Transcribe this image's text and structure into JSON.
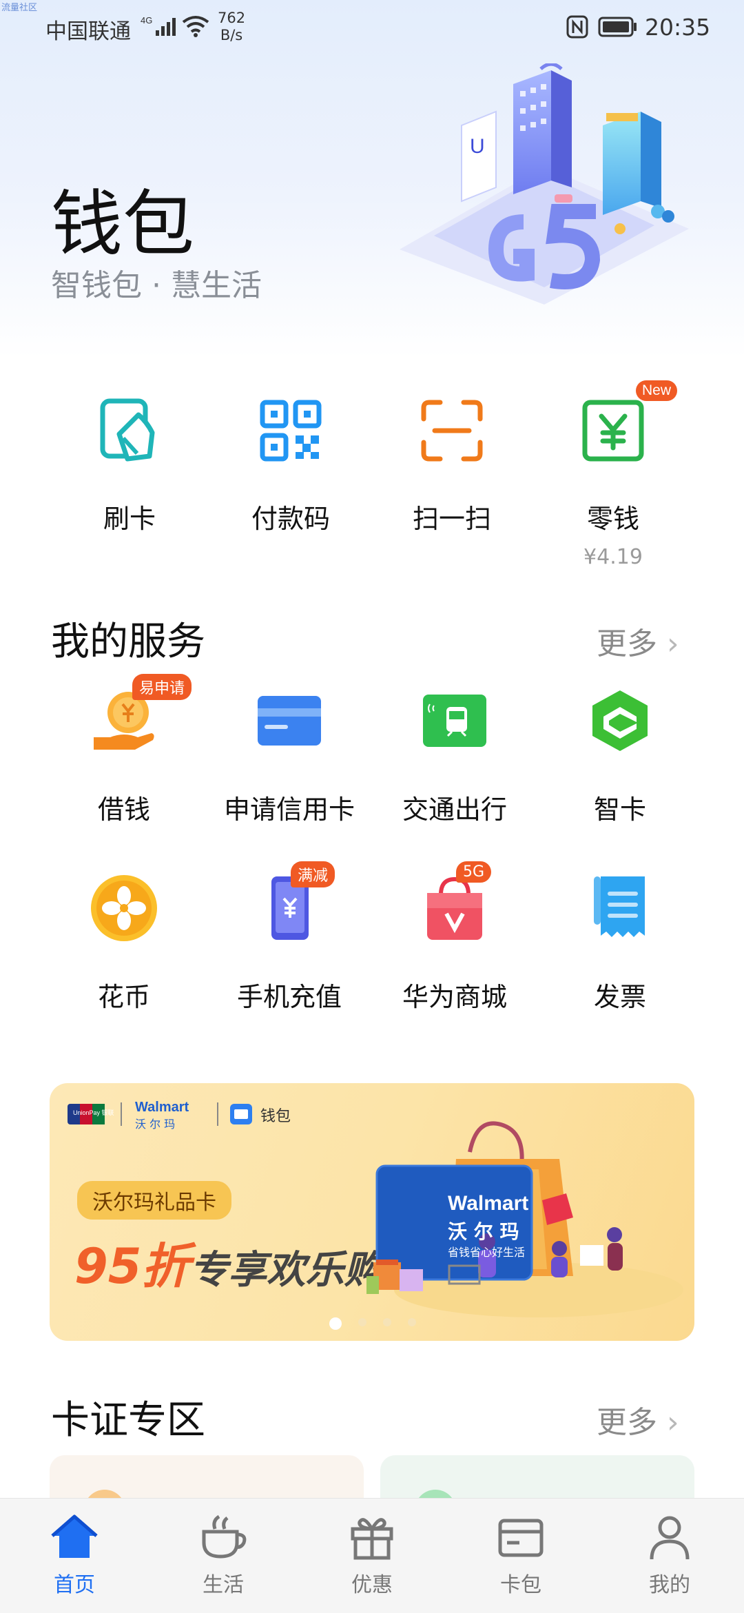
{
  "status_bar": {
    "watermark": "流量社区",
    "carrier": "中国联通",
    "net_speed_value": "762",
    "net_speed_unit": "B/s",
    "time": "20:35"
  },
  "header": {
    "title": "钱包",
    "subtitle": "智钱包 · 慧生活"
  },
  "quick_actions": [
    {
      "label": "刷卡",
      "icon": "card-swipe-icon",
      "color": "#1fb5b8"
    },
    {
      "label": "付款码",
      "icon": "qr-code-icon",
      "color": "#2196f3"
    },
    {
      "label": "扫一扫",
      "icon": "scan-icon",
      "color": "#f07a1a"
    },
    {
      "label": "零钱",
      "icon": "yuan-wallet-icon",
      "color": "#2bb24c",
      "badge": "New",
      "sub": "¥4.19"
    }
  ],
  "services_section": {
    "title": "我的服务",
    "more": "更多",
    "items": [
      {
        "label": "借钱",
        "icon": "coin-hand-icon",
        "badge": "易申请"
      },
      {
        "label": "申请信用卡",
        "icon": "credit-card-icon"
      },
      {
        "label": "交通出行",
        "icon": "transit-card-icon"
      },
      {
        "label": "智卡",
        "icon": "smart-card-icon"
      },
      {
        "label": "花币",
        "icon": "flower-coin-icon"
      },
      {
        "label": "手机充值",
        "icon": "phone-topup-icon",
        "badge": "满减"
      },
      {
        "label": "华为商城",
        "icon": "shopping-bag-icon",
        "badge": "5G"
      },
      {
        "label": "发票",
        "icon": "invoice-icon"
      }
    ]
  },
  "banner": {
    "logo_unionpay": "UnionPay 银联",
    "logo_walmart": "Walmart",
    "logo_walmart_cn": "沃 尔 玛",
    "logo_wallet": "钱包",
    "tag": "沃尔玛礼品卡",
    "headline_accent": "95折",
    "headline_rest": "专享欢乐购",
    "card_brand": "Walmart",
    "card_brand_cn": "沃 尔 玛",
    "card_slogan": "省钱省心好生活",
    "page_count": 4,
    "active_page": 1
  },
  "cards_section": {
    "title": "卡证专区",
    "more": "更多"
  },
  "bottom_nav": [
    {
      "label": "首页",
      "icon": "home-icon",
      "active": true
    },
    {
      "label": "生活",
      "icon": "coffee-cup-icon",
      "active": false
    },
    {
      "label": "优惠",
      "icon": "gift-icon",
      "active": false
    },
    {
      "label": "卡包",
      "icon": "card-wallet-icon",
      "active": false
    },
    {
      "label": "我的",
      "icon": "profile-icon",
      "active": false
    }
  ],
  "colors": {
    "accent": "#1f6ff2",
    "badge": "#f05a24"
  }
}
